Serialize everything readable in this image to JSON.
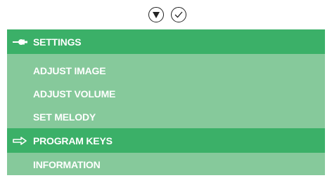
{
  "topbar": {
    "icons": [
      "down-circle-icon",
      "check-circle-icon"
    ]
  },
  "menu": {
    "title": "SETTINGS",
    "title_icon": "wrench-icon",
    "items": [
      {
        "label": "ADJUST IMAGE",
        "selected": false
      },
      {
        "label": "ADJUST VOLUME",
        "selected": false
      },
      {
        "label": "SET MELODY",
        "selected": false
      },
      {
        "label": "PROGRAM KEYS",
        "selected": true,
        "icon": "right-arrow-icon"
      },
      {
        "label": "INFORMATION",
        "selected": false
      }
    ]
  },
  "colors": {
    "panel": "#86c99b",
    "highlight": "#3bb068",
    "text": "#ffffff"
  }
}
